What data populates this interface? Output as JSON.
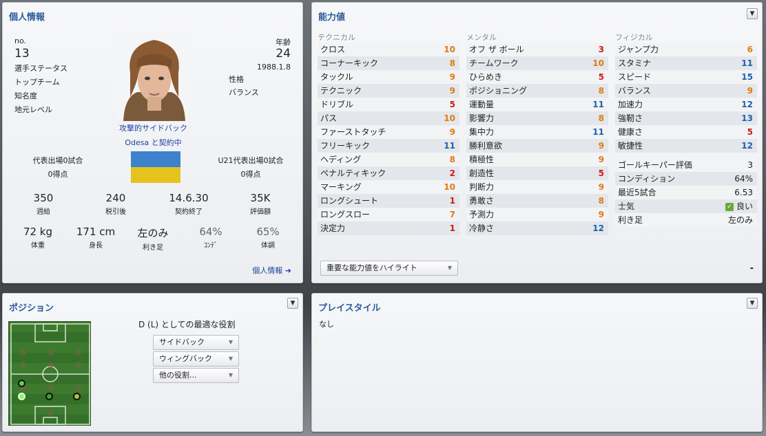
{
  "personal": {
    "title": "個人情報",
    "no_label": "no.",
    "no_value": "13",
    "age_label": "年齢",
    "age_value": "24",
    "birth_date": "1988.1.8",
    "left_labels": [
      "選手ステータス",
      "トップチーム",
      "知名度",
      "地元レベル"
    ],
    "personality_label": "性格",
    "personality_value": "バランス",
    "position_role": "攻撃的サイドバック",
    "contract_text": "Odesa と契約中",
    "intl_caps": "代表出場0試合",
    "intl_goals": "0得点",
    "u21_caps": "U21代表出場0試合",
    "u21_goals": "0得点",
    "stats1": [
      {
        "value": "350",
        "label": "週給"
      },
      {
        "value": "240",
        "label": "税引後"
      },
      {
        "value": "14.6.30",
        "label": "契約終了"
      },
      {
        "value": "35K",
        "label": "評価額"
      }
    ],
    "stats2": [
      {
        "value": "72 kg",
        "label": "体重"
      },
      {
        "value": "171 cm",
        "label": "身長"
      },
      {
        "value": "左のみ",
        "label": "利き足"
      },
      {
        "value": "64%",
        "label": "ｺﾝﾃﾞ"
      },
      {
        "value": "65%",
        "label": "体調"
      }
    ],
    "link_label": "個人情報 ➜",
    "flag_colors": {
      "top": "#3d82cc",
      "bottom": "#e6c21e"
    }
  },
  "abilities": {
    "title": "能力値",
    "technical_head": "テクニカル",
    "mental_head": "メンタル",
    "physical_head": "フィジカル",
    "technical": [
      {
        "name": "クロス",
        "value": "10",
        "color": "orange"
      },
      {
        "name": "コーナーキック",
        "value": "8",
        "color": "orange"
      },
      {
        "name": "タックル",
        "value": "9",
        "color": "orange"
      },
      {
        "name": "テクニック",
        "value": "9",
        "color": "orange"
      },
      {
        "name": "ドリブル",
        "value": "5",
        "color": "red"
      },
      {
        "name": "パス",
        "value": "10",
        "color": "orange"
      },
      {
        "name": "ファーストタッチ",
        "value": "9",
        "color": "orange"
      },
      {
        "name": "フリーキック",
        "value": "11",
        "color": "blue"
      },
      {
        "name": "ヘディング",
        "value": "8",
        "color": "orange"
      },
      {
        "name": "ペナルティキック",
        "value": "2",
        "color": "red"
      },
      {
        "name": "マーキング",
        "value": "10",
        "color": "orange"
      },
      {
        "name": "ロングシュート",
        "value": "1",
        "color": "red"
      },
      {
        "name": "ロングスロー",
        "value": "7",
        "color": "orange"
      },
      {
        "name": "決定力",
        "value": "1",
        "color": "red"
      }
    ],
    "mental": [
      {
        "name": "オフ ザ ボール",
        "value": "3",
        "color": "red"
      },
      {
        "name": "チームワーク",
        "value": "10",
        "color": "orange"
      },
      {
        "name": "ひらめき",
        "value": "5",
        "color": "red"
      },
      {
        "name": "ポジショニング",
        "value": "8",
        "color": "orange"
      },
      {
        "name": "運動量",
        "value": "11",
        "color": "blue"
      },
      {
        "name": "影響力",
        "value": "8",
        "color": "orange"
      },
      {
        "name": "集中力",
        "value": "11",
        "color": "blue"
      },
      {
        "name": "勝利意欲",
        "value": "9",
        "color": "orange"
      },
      {
        "name": "積極性",
        "value": "9",
        "color": "orange"
      },
      {
        "name": "創造性",
        "value": "5",
        "color": "red"
      },
      {
        "name": "判断力",
        "value": "9",
        "color": "orange"
      },
      {
        "name": "勇敢さ",
        "value": "8",
        "color": "orange"
      },
      {
        "name": "予測力",
        "value": "9",
        "color": "orange"
      },
      {
        "name": "冷静さ",
        "value": "12",
        "color": "blue"
      }
    ],
    "physical": [
      {
        "name": "ジャンプ力",
        "value": "6",
        "color": "orange"
      },
      {
        "name": "スタミナ",
        "value": "11",
        "color": "blue"
      },
      {
        "name": "スピード",
        "value": "15",
        "color": "blue"
      },
      {
        "name": "バランス",
        "value": "9",
        "color": "orange"
      },
      {
        "name": "加速力",
        "value": "12",
        "color": "blue"
      },
      {
        "name": "強靭さ",
        "value": "13",
        "color": "blue"
      },
      {
        "name": "健康さ",
        "value": "5",
        "color": "red"
      },
      {
        "name": "敏捷性",
        "value": "12",
        "color": "blue"
      }
    ],
    "extra": [
      {
        "name": "ゴールキーパー評価",
        "value": "3"
      },
      {
        "name": "コンディション",
        "value": "64%"
      },
      {
        "name": "最近5試合",
        "value": "6.53"
      },
      {
        "name": "士気",
        "value": "良い"
      },
      {
        "name": "利き足",
        "value": "左のみ"
      }
    ],
    "highlight_select": "重要な能力値をハイライト",
    "minus": "-"
  },
  "position": {
    "title": "ポジション",
    "best_role": "D (L) としての最適な役割",
    "roles": [
      "サイドバック",
      "ウィングバック",
      "他の役割..."
    ]
  },
  "playstyle": {
    "title": "プレイスタイル",
    "value": "なし"
  }
}
